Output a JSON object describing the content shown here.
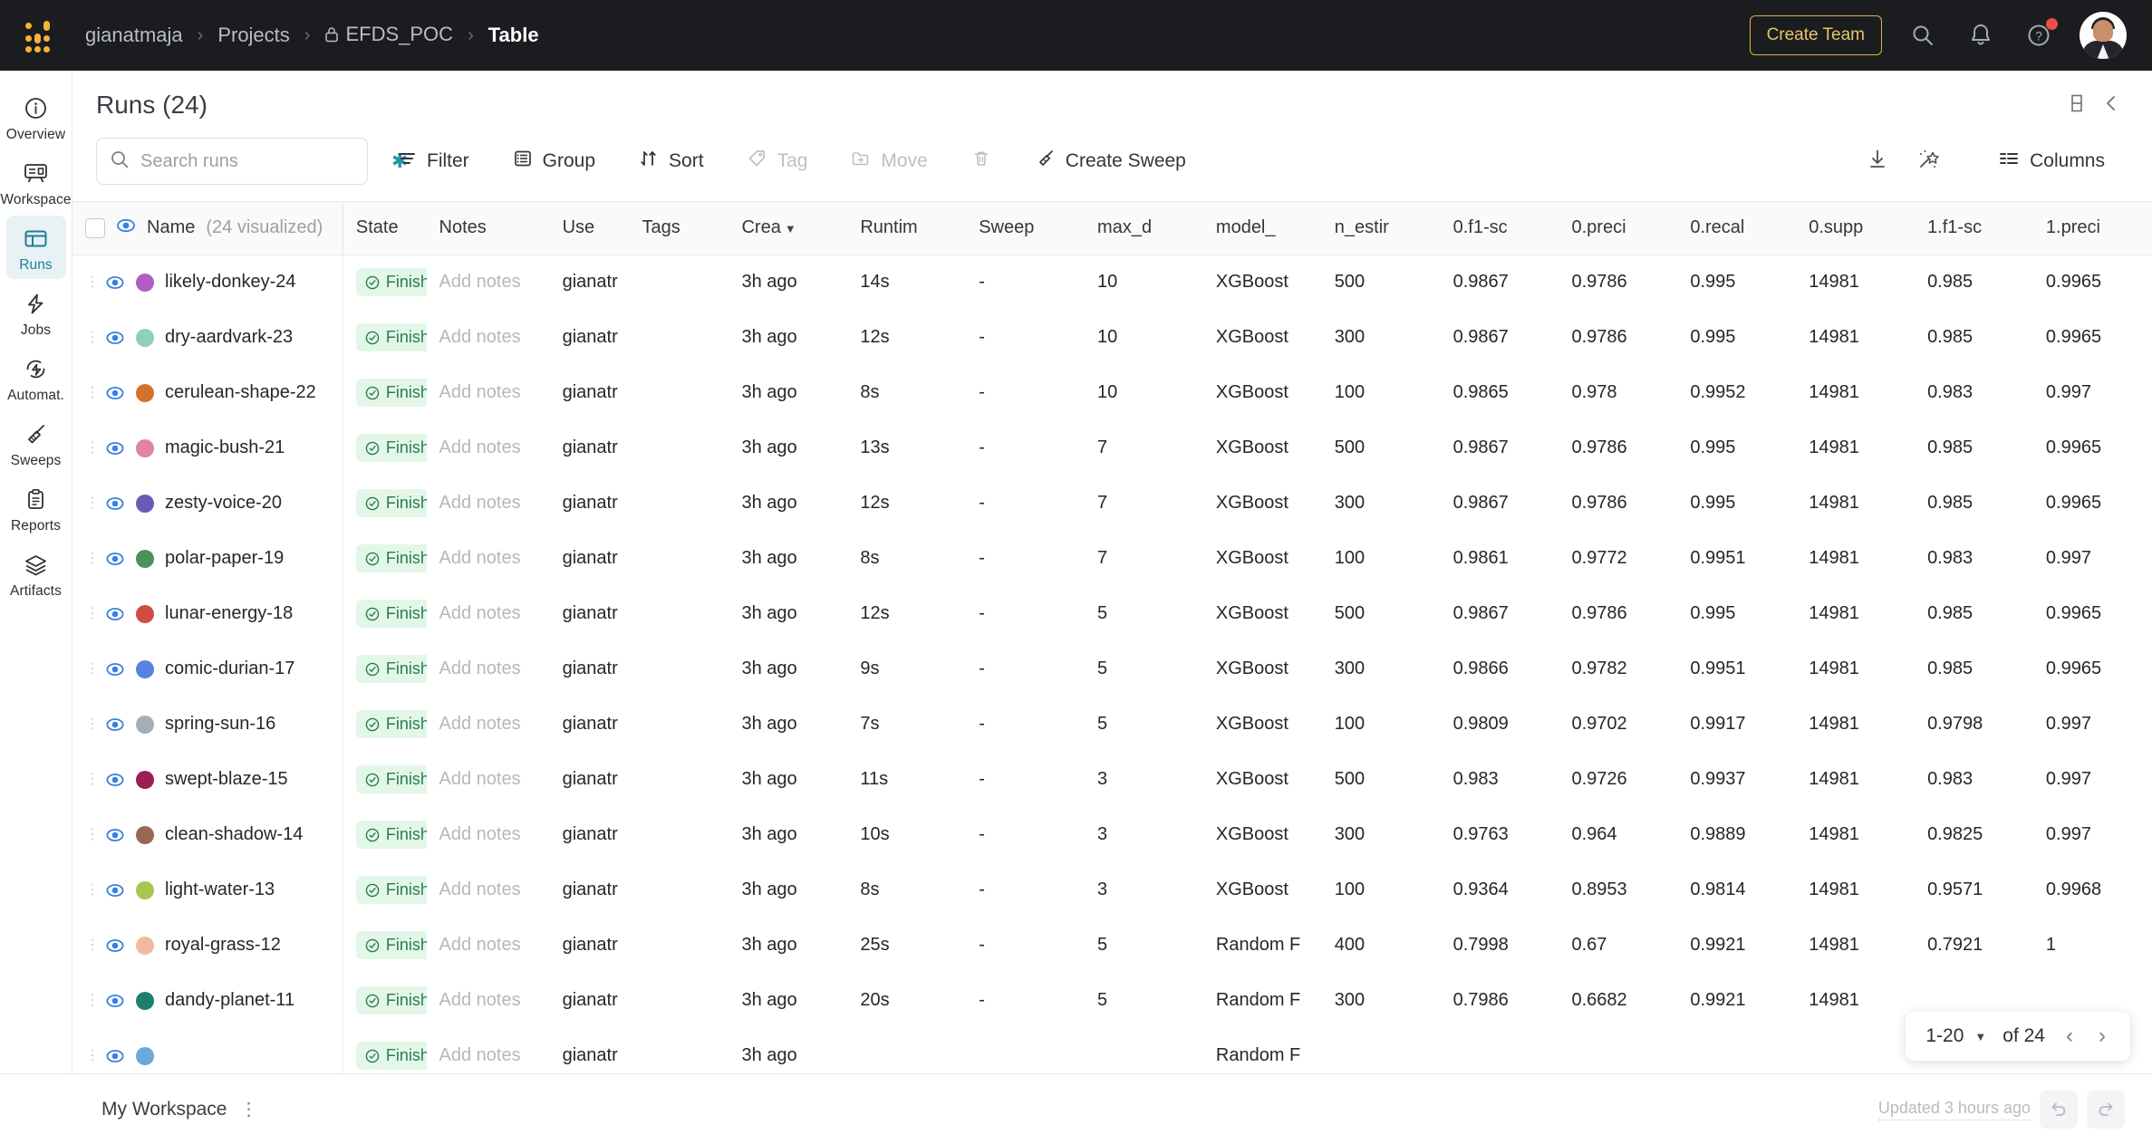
{
  "header": {
    "breadcrumbs": [
      {
        "label": "gianatmaja",
        "icon": null,
        "active": false
      },
      {
        "label": "Projects",
        "icon": null,
        "active": false
      },
      {
        "label": "EFDS_POC",
        "icon": "lock-icon",
        "active": false
      },
      {
        "label": "Table",
        "icon": null,
        "active": true
      }
    ],
    "create_team_label": "Create Team",
    "icons": [
      "search-icon",
      "bell-icon",
      "help-icon"
    ],
    "help_has_badge": true
  },
  "sidebar": {
    "items": [
      {
        "label": "Overview",
        "icon": "info-circle-icon",
        "active": false
      },
      {
        "label": "Workspace",
        "icon": "workspace-icon",
        "active": false
      },
      {
        "label": "Runs",
        "icon": "runs-table-icon",
        "active": true
      },
      {
        "label": "Jobs",
        "icon": "bolt-icon",
        "active": false
      },
      {
        "label": "Automat.",
        "icon": "automation-icon",
        "active": false
      },
      {
        "label": "Sweeps",
        "icon": "broom-icon",
        "active": false
      },
      {
        "label": "Reports",
        "icon": "clipboard-icon",
        "active": false
      },
      {
        "label": "Artifacts",
        "icon": "layers-icon",
        "active": false
      }
    ]
  },
  "page": {
    "title": "Runs (24)",
    "panel_icon": "panel-split-icon",
    "collapse_icon": "chevron-left-icon"
  },
  "toolbar": {
    "search_placeholder": "Search runs",
    "search_value": "",
    "sparkle_icon": "sparkle-icon",
    "buttons": [
      {
        "label": "Filter",
        "icon": "filter-icon",
        "disabled": false
      },
      {
        "label": "Group",
        "icon": "group-icon",
        "disabled": false
      },
      {
        "label": "Sort",
        "icon": "sort-icon",
        "disabled": false
      },
      {
        "label": "Tag",
        "icon": "tag-icon",
        "disabled": true
      },
      {
        "label": "Move",
        "icon": "move-icon",
        "disabled": true
      },
      {
        "label": "",
        "icon": "trash-icon",
        "disabled": true
      },
      {
        "label": "Create Sweep",
        "icon": "broom-icon",
        "disabled": false
      }
    ],
    "right_buttons": [
      {
        "label": "",
        "icon": "download-icon"
      },
      {
        "label": "",
        "icon": "magic-wand-icon"
      },
      {
        "label": "Columns",
        "icon": "columns-icon"
      }
    ]
  },
  "table": {
    "name_header": "Name",
    "name_header_sub": "(24 visualized)",
    "columns": [
      {
        "key": "state",
        "label": "State",
        "sorted": false
      },
      {
        "key": "notes",
        "label": "Notes",
        "sorted": false
      },
      {
        "key": "user",
        "label": "Use",
        "sorted": false
      },
      {
        "key": "tags",
        "label": "Tags",
        "sorted": false
      },
      {
        "key": "crea",
        "label": "Crea",
        "sorted": true
      },
      {
        "key": "runtime",
        "label": "Runtim",
        "sorted": false
      },
      {
        "key": "sweep",
        "label": "Sweep",
        "sorted": false
      },
      {
        "key": "max_d",
        "label": "max_d",
        "sorted": false
      },
      {
        "key": "model",
        "label": "model_",
        "sorted": false
      },
      {
        "key": "n_est",
        "label": "n_estir",
        "sorted": false
      },
      {
        "key": "f1_0",
        "label": "0.f1-sc",
        "sorted": false
      },
      {
        "key": "prec_0",
        "label": "0.preci",
        "sorted": false
      },
      {
        "key": "rec_0",
        "label": "0.recal",
        "sorted": false
      },
      {
        "key": "sup_0",
        "label": "0.supp",
        "sorted": false
      },
      {
        "key": "f1_1",
        "label": "1.f1-sc",
        "sorted": false
      },
      {
        "key": "prec_1",
        "label": "1.preci",
        "sorted": false
      }
    ],
    "rows": [
      {
        "name": "likely-donkey-24",
        "color": "#b05ec4",
        "state": "Finished",
        "notes": "Add notes",
        "user": "gianatr",
        "tags": "",
        "crea": "3h ago",
        "runtime": "14s",
        "sweep": "-",
        "max_d": "10",
        "model": "XGBoost",
        "n_est": "500",
        "f1_0": "0.9867",
        "prec_0": "0.9786",
        "rec_0": "0.995",
        "sup_0": "14981",
        "f1_1": "0.985",
        "prec_1": "0.9965"
      },
      {
        "name": "dry-aardvark-23",
        "color": "#8fcfbd",
        "state": "Finished",
        "notes": "Add notes",
        "user": "gianatr",
        "tags": "",
        "crea": "3h ago",
        "runtime": "12s",
        "sweep": "-",
        "max_d": "10",
        "model": "XGBoost",
        "n_est": "300",
        "f1_0": "0.9867",
        "prec_0": "0.9786",
        "rec_0": "0.995",
        "sup_0": "14981",
        "f1_1": "0.985",
        "prec_1": "0.9965"
      },
      {
        "name": "cerulean-shape-22",
        "color": "#d4712c",
        "state": "Finished",
        "notes": "Add notes",
        "user": "gianatr",
        "tags": "",
        "crea": "3h ago",
        "runtime": "8s",
        "sweep": "-",
        "max_d": "10",
        "model": "XGBoost",
        "n_est": "100",
        "f1_0": "0.9865",
        "prec_0": "0.978",
        "rec_0": "0.9952",
        "sup_0": "14981",
        "f1_1": "0.983",
        "prec_1": "0.997"
      },
      {
        "name": "magic-bush-21",
        "color": "#e083a6",
        "state": "Finished",
        "notes": "Add notes",
        "user": "gianatr",
        "tags": "",
        "crea": "3h ago",
        "runtime": "13s",
        "sweep": "-",
        "max_d": "7",
        "model": "XGBoost",
        "n_est": "500",
        "f1_0": "0.9867",
        "prec_0": "0.9786",
        "rec_0": "0.995",
        "sup_0": "14981",
        "f1_1": "0.985",
        "prec_1": "0.9965"
      },
      {
        "name": "zesty-voice-20",
        "color": "#6c5ab5",
        "state": "Finished",
        "notes": "Add notes",
        "user": "gianatr",
        "tags": "",
        "crea": "3h ago",
        "runtime": "12s",
        "sweep": "-",
        "max_d": "7",
        "model": "XGBoost",
        "n_est": "300",
        "f1_0": "0.9867",
        "prec_0": "0.9786",
        "rec_0": "0.995",
        "sup_0": "14981",
        "f1_1": "0.985",
        "prec_1": "0.9965"
      },
      {
        "name": "polar-paper-19",
        "color": "#4d9059",
        "state": "Finished",
        "notes": "Add notes",
        "user": "gianatr",
        "tags": "",
        "crea": "3h ago",
        "runtime": "8s",
        "sweep": "-",
        "max_d": "7",
        "model": "XGBoost",
        "n_est": "100",
        "f1_0": "0.9861",
        "prec_0": "0.9772",
        "rec_0": "0.9951",
        "sup_0": "14981",
        "f1_1": "0.983",
        "prec_1": "0.997"
      },
      {
        "name": "lunar-energy-18",
        "color": "#cf4b44",
        "state": "Finished",
        "notes": "Add notes",
        "user": "gianatr",
        "tags": "",
        "crea": "3h ago",
        "runtime": "12s",
        "sweep": "-",
        "max_d": "5",
        "model": "XGBoost",
        "n_est": "500",
        "f1_0": "0.9867",
        "prec_0": "0.9786",
        "rec_0": "0.995",
        "sup_0": "14981",
        "f1_1": "0.985",
        "prec_1": "0.9965"
      },
      {
        "name": "comic-durian-17",
        "color": "#5583dd",
        "state": "Finished",
        "notes": "Add notes",
        "user": "gianatr",
        "tags": "",
        "crea": "3h ago",
        "runtime": "9s",
        "sweep": "-",
        "max_d": "5",
        "model": "XGBoost",
        "n_est": "300",
        "f1_0": "0.9866",
        "prec_0": "0.9782",
        "rec_0": "0.9951",
        "sup_0": "14981",
        "f1_1": "0.985",
        "prec_1": "0.9965"
      },
      {
        "name": "spring-sun-16",
        "color": "#a6adb5",
        "state": "Finished",
        "notes": "Add notes",
        "user": "gianatr",
        "tags": "",
        "crea": "3h ago",
        "runtime": "7s",
        "sweep": "-",
        "max_d": "5",
        "model": "XGBoost",
        "n_est": "100",
        "f1_0": "0.9809",
        "prec_0": "0.9702",
        "rec_0": "0.9917",
        "sup_0": "14981",
        "f1_1": "0.9798",
        "prec_1": "0.997"
      },
      {
        "name": "swept-blaze-15",
        "color": "#9b1f55",
        "state": "Finished",
        "notes": "Add notes",
        "user": "gianatr",
        "tags": "",
        "crea": "3h ago",
        "runtime": "11s",
        "sweep": "-",
        "max_d": "3",
        "model": "XGBoost",
        "n_est": "500",
        "f1_0": "0.983",
        "prec_0": "0.9726",
        "rec_0": "0.9937",
        "sup_0": "14981",
        "f1_1": "0.983",
        "prec_1": "0.997"
      },
      {
        "name": "clean-shadow-14",
        "color": "#9a6752",
        "state": "Finished",
        "notes": "Add notes",
        "user": "gianatr",
        "tags": "",
        "crea": "3h ago",
        "runtime": "10s",
        "sweep": "-",
        "max_d": "3",
        "model": "XGBoost",
        "n_est": "300",
        "f1_0": "0.9763",
        "prec_0": "0.964",
        "rec_0": "0.9889",
        "sup_0": "14981",
        "f1_1": "0.9825",
        "prec_1": "0.997"
      },
      {
        "name": "light-water-13",
        "color": "#a5c74f",
        "state": "Finished",
        "notes": "Add notes",
        "user": "gianatr",
        "tags": "",
        "crea": "3h ago",
        "runtime": "8s",
        "sweep": "-",
        "max_d": "3",
        "model": "XGBoost",
        "n_est": "100",
        "f1_0": "0.9364",
        "prec_0": "0.8953",
        "rec_0": "0.9814",
        "sup_0": "14981",
        "f1_1": "0.9571",
        "prec_1": "0.9968"
      },
      {
        "name": "royal-grass-12",
        "color": "#f0bb9c",
        "state": "Finished",
        "notes": "Add notes",
        "user": "gianatr",
        "tags": "",
        "crea": "3h ago",
        "runtime": "25s",
        "sweep": "-",
        "max_d": "5",
        "model": "Random F",
        "n_est": "400",
        "f1_0": "0.7998",
        "prec_0": "0.67",
        "rec_0": "0.9921",
        "sup_0": "14981",
        "f1_1": "0.7921",
        "prec_1": "1"
      },
      {
        "name": "dandy-planet-11",
        "color": "#1f7f6e",
        "state": "Finished",
        "notes": "Add notes",
        "user": "gianatr",
        "tags": "",
        "crea": "3h ago",
        "runtime": "20s",
        "sweep": "-",
        "max_d": "5",
        "model": "Random F",
        "n_est": "300",
        "f1_0": "0.7986",
        "prec_0": "0.6682",
        "rec_0": "0.9921",
        "sup_0": "14981",
        "f1_1": "",
        "prec_1": ""
      },
      {
        "name": "",
        "color": "#6aa9dd",
        "state": "Finished",
        "notes": "Add notes",
        "user": "gianatr",
        "tags": "",
        "crea": "3h ago",
        "runtime": "",
        "sweep": "",
        "max_d": "",
        "model": "Random F",
        "n_est": "",
        "f1_0": "",
        "prec_0": "",
        "rec_0": "",
        "sup_0": "",
        "f1_1": "",
        "prec_1": ""
      }
    ]
  },
  "pagination": {
    "range": "1-20",
    "of_label": "of 24",
    "prev_icon": "chevron-left-icon",
    "next_icon": "chevron-right-icon"
  },
  "footer": {
    "workspace": "My Workspace",
    "kebab_icon": "kebab-menu-icon",
    "updated": "Updated 3 hours ago",
    "undo_icon": "undo-icon",
    "redo_icon": "redo-icon"
  },
  "colors": {
    "accent": "#1d7f96",
    "brand_yellow": "#f5b335",
    "topbar_bg": "#1a1c1f",
    "finished_bg": "#e3f7e9",
    "finished_fg": "#2a7d4f"
  }
}
